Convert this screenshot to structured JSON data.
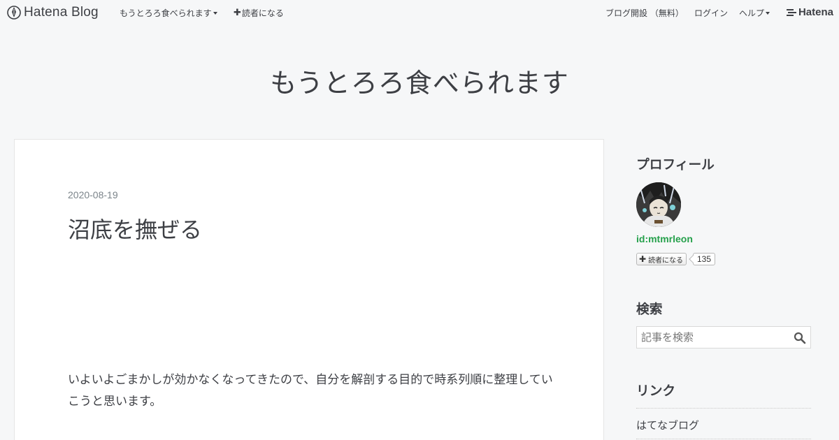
{
  "header": {
    "logo_text": "Hatena Blog",
    "blog_menu_label": "もうとろろ食べられます",
    "subscribe_label": "読者になる",
    "start_blog_label": "ブログ開設 （無料）",
    "login_label": "ログイン",
    "help_label": "ヘルプ",
    "hatena_label": "Hatena"
  },
  "blog": {
    "title": "もうとろろ食べられます"
  },
  "entry": {
    "date": "2020-08-19",
    "title": "沼底を撫ぜる",
    "body": "いよいよごまかしが効かなくなってきたので、自分を解剖する目的で時系列順に整理していこうと思います。"
  },
  "sidebar": {
    "profile_heading": "プロフィール",
    "profile_id": "id:mtmrleon",
    "subscribe_label": "読者になる",
    "subscriber_count": "135",
    "search_heading": "検索",
    "search_placeholder": "記事を検索",
    "links_heading": "リンク",
    "links": [
      "はてなブログ"
    ]
  },
  "colors": {
    "background": "#f6f7f8",
    "text": "#3d3f44",
    "profile_id": "#25a04b",
    "date": "#7b848a"
  }
}
